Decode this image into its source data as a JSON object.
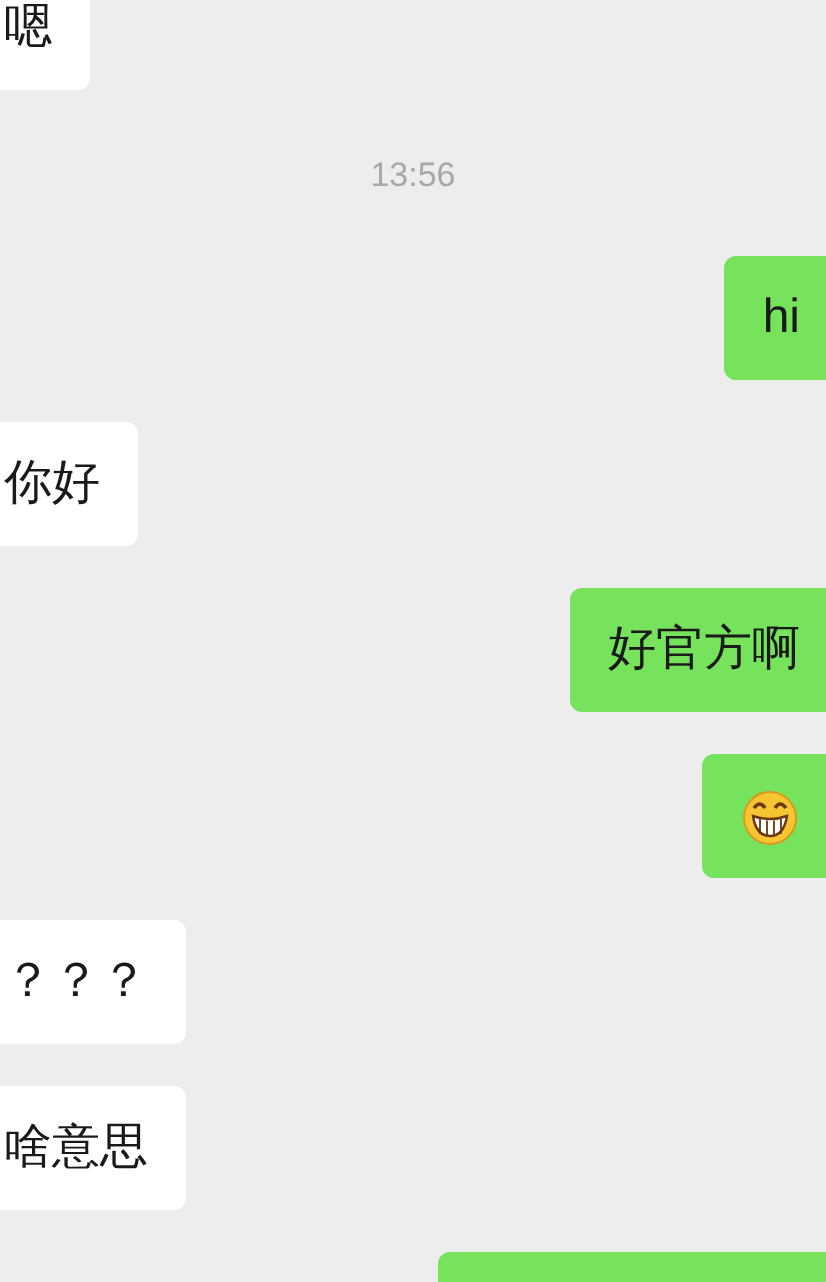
{
  "messages": [
    {
      "kind": "text",
      "outgoing": false,
      "text": "嗯"
    },
    {
      "kind": "time",
      "text": "13:56"
    },
    {
      "kind": "text",
      "outgoing": true,
      "text": "hi"
    },
    {
      "kind": "text",
      "outgoing": false,
      "text": "你好"
    },
    {
      "kind": "text",
      "outgoing": true,
      "text": "好官方啊"
    },
    {
      "kind": "emoji",
      "outgoing": true
    },
    {
      "kind": "text",
      "outgoing": false,
      "text": "？？？"
    },
    {
      "kind": "text",
      "outgoing": false,
      "text": "啥意思"
    },
    {
      "kind": "cut",
      "outgoing": true
    }
  ]
}
